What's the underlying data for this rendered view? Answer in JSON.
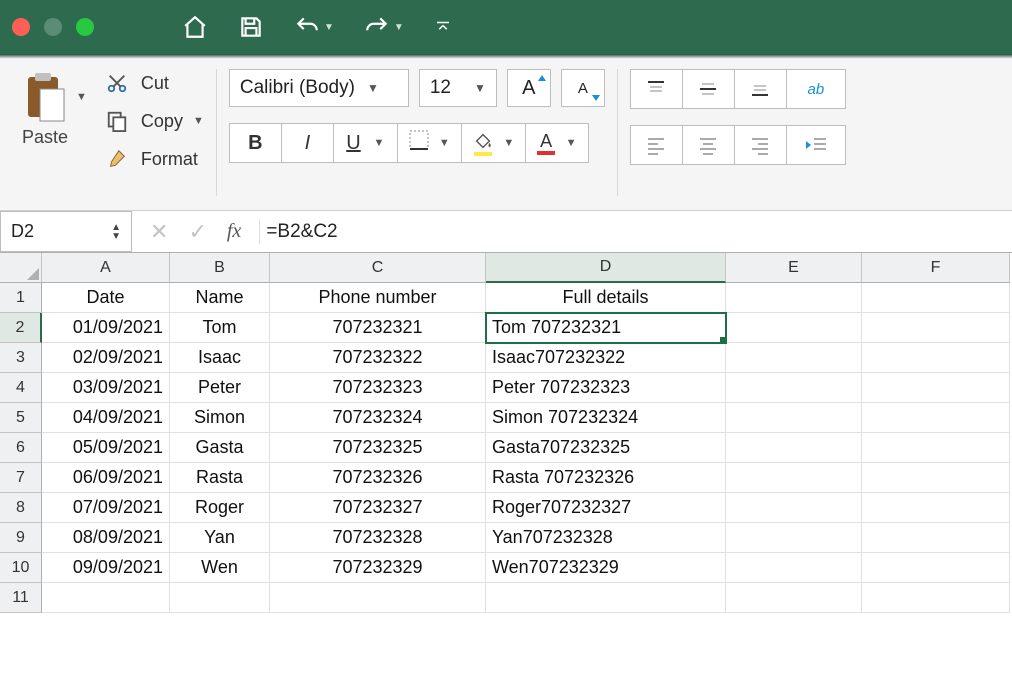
{
  "titlebar": {
    "icons": {
      "home": "home-icon",
      "save": "save-icon",
      "undo": "undo-icon",
      "redo": "redo-icon",
      "customize": "customize-icon"
    }
  },
  "ribbon": {
    "paste_label": "Paste",
    "cut_label": "Cut",
    "copy_label": "Copy",
    "format_label": "Format",
    "font_name": "Calibri (Body)",
    "font_size": "12",
    "bold": "B",
    "italic": "I",
    "underline": "U",
    "grow_font": "A",
    "shrink_font": "A",
    "font_color_letter": "A"
  },
  "formula_bar": {
    "cell_ref": "D2",
    "fx": "fx",
    "formula": "=B2&C2"
  },
  "columns": [
    {
      "id": "A",
      "class": "cw-A"
    },
    {
      "id": "B",
      "class": "cw-B"
    },
    {
      "id": "C",
      "class": "cw-C"
    },
    {
      "id": "D",
      "class": "cw-D"
    },
    {
      "id": "E",
      "class": "cw-E"
    },
    {
      "id": "F",
      "class": "cw-F"
    }
  ],
  "selected_col": "D",
  "selected_row": 2,
  "headers": {
    "A": "Date",
    "B": "Name",
    "C": "Phone number",
    "D": "Full details"
  },
  "rows": [
    {
      "n": 1,
      "A": "Date",
      "B": "Name",
      "C": "Phone number",
      "D": "Full details",
      "align": {
        "A": "c",
        "B": "c",
        "C": "c",
        "D": "c"
      }
    },
    {
      "n": 2,
      "A": "01/09/2021",
      "B": "Tom",
      "C": "707232321",
      "D": "Tom 707232321"
    },
    {
      "n": 3,
      "A": "02/09/2021",
      "B": "Isaac",
      "C": "707232322",
      "D": "Isaac707232322"
    },
    {
      "n": 4,
      "A": "03/09/2021",
      "B": "Peter",
      "C": "707232323",
      "D": "Peter 707232323"
    },
    {
      "n": 5,
      "A": "04/09/2021",
      "B": "Simon",
      "C": "707232324",
      "D": "Simon 707232324"
    },
    {
      "n": 6,
      "A": "05/09/2021",
      "B": "Gasta",
      "C": "707232325",
      "D": "Gasta707232325"
    },
    {
      "n": 7,
      "A": "06/09/2021",
      "B": "Rasta",
      "C": "707232326",
      "D": "Rasta 707232326"
    },
    {
      "n": 8,
      "A": "07/09/2021",
      "B": "Roger",
      "C": "707232327",
      "D": "Roger707232327"
    },
    {
      "n": 9,
      "A": "08/09/2021",
      "B": "Yan",
      "C": "707232328",
      "D": "Yan707232328"
    },
    {
      "n": 10,
      "A": "09/09/2021",
      "B": "Wen",
      "C": "707232329",
      "D": "Wen707232329"
    },
    {
      "n": 11
    }
  ]
}
